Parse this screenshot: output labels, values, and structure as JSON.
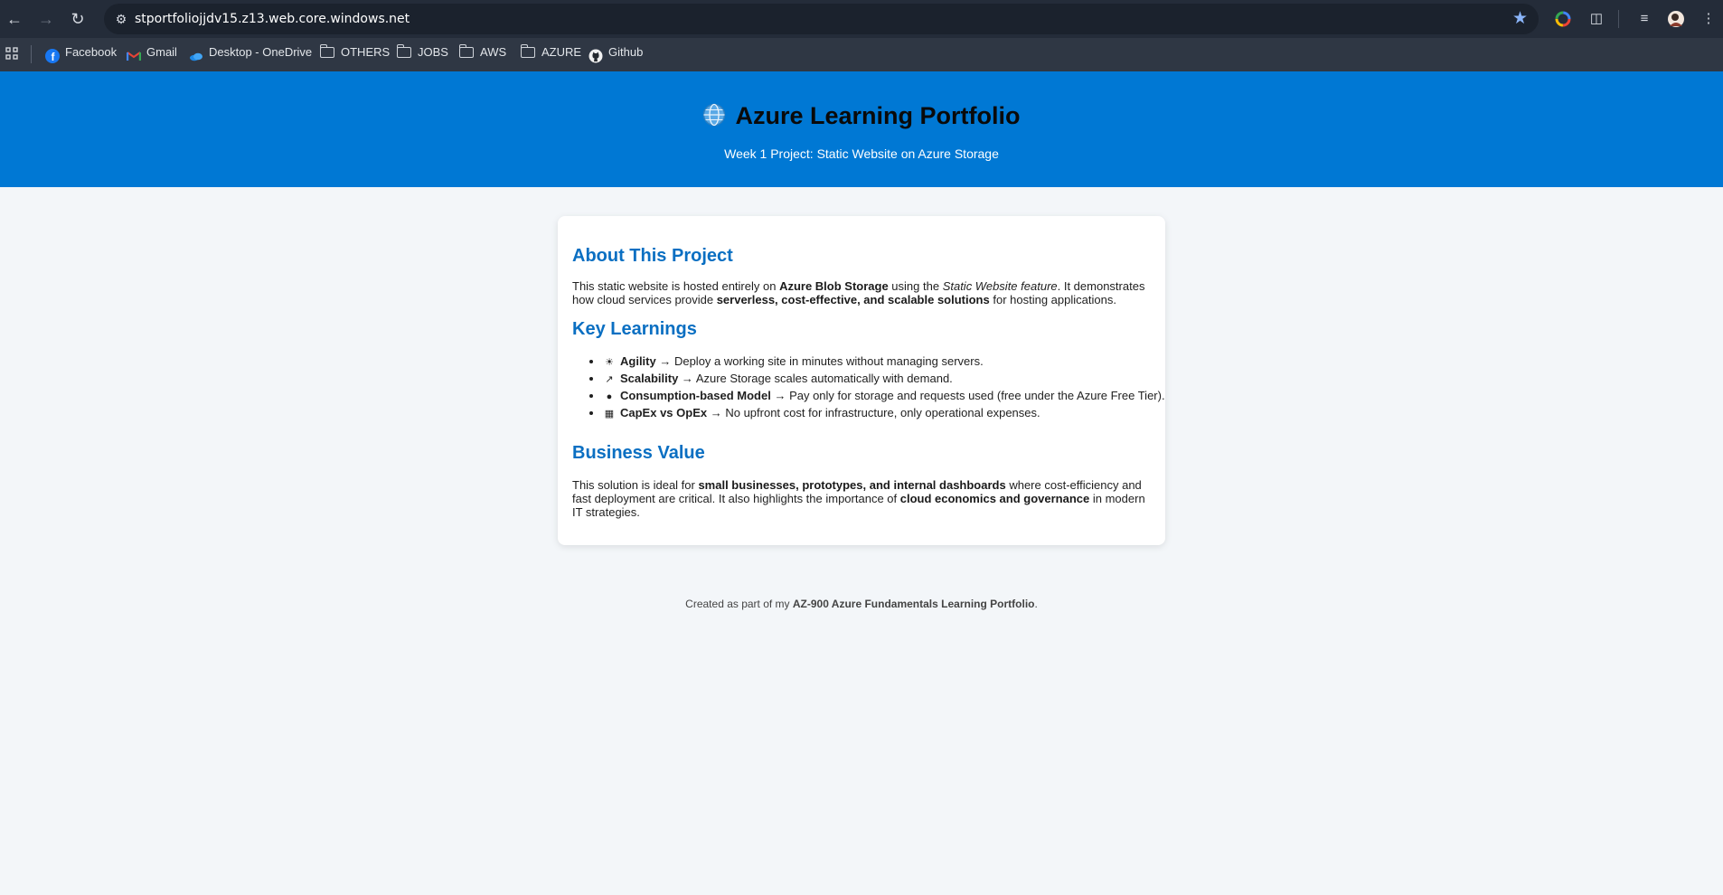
{
  "browser": {
    "url": "stportfoliojjdv15.z13.web.core.windows.net",
    "bookmarks": [
      {
        "label": "Facebook",
        "icon": "facebook-icon"
      },
      {
        "label": "Gmail",
        "icon": "gmail-icon"
      },
      {
        "label": "Desktop - OneDrive",
        "icon": "onedrive-icon"
      },
      {
        "label": "OTHERS",
        "icon": "folder-icon"
      },
      {
        "label": "JOBS",
        "icon": "folder-icon"
      },
      {
        "label": "AWS",
        "icon": "folder-icon"
      },
      {
        "label": "AZURE",
        "icon": "folder-icon"
      },
      {
        "label": "Github",
        "icon": "github-icon"
      }
    ]
  },
  "header": {
    "title": "Azure Learning Portfolio",
    "subtitle": "Week 1 Project: Static Website on Azure Storage",
    "background": "#0078d4"
  },
  "about": {
    "heading": "About This Project",
    "p1": "This static website is hosted entirely on ",
    "b1": "Azure Blob Storage",
    "p2": " using the ",
    "i1": "Static Website feature",
    "p3": ". It demonstrates how cloud services provide ",
    "b2": "serverless, cost-effective, and scalable solutions",
    "p4": " for hosting applications."
  },
  "learnings": {
    "heading": "Key Learnings",
    "items": [
      {
        "icon": "lightbulb-icon",
        "title": "Agility",
        "text": " → Deploy a working site in minutes without managing servers."
      },
      {
        "icon": "chart-icon",
        "title": "Scalability",
        "text": " → Azure Storage scales automatically with demand."
      },
      {
        "icon": "money-bag-icon",
        "title": "Consumption-based Model",
        "text": " → Pay only for storage and requests used (free under the Azure Free Tier)."
      },
      {
        "icon": "building-icon",
        "title": "CapEx vs OpEx",
        "text": " → No upfront cost for infrastructure, only operational expenses."
      }
    ]
  },
  "business": {
    "heading": "Business Value",
    "p1": "This solution is ideal for ",
    "b1": "small businesses, prototypes, and internal dashboards",
    "p2": " where cost-efficiency and fast deployment are critical. It also highlights the importance of ",
    "b2": "cloud economics and governance",
    "p3": " in modern IT strategies."
  },
  "footer": {
    "pre": "Created as part of my ",
    "bold": "AZ-900 Azure Fundamentals Learning Portfolio",
    "post": "."
  }
}
